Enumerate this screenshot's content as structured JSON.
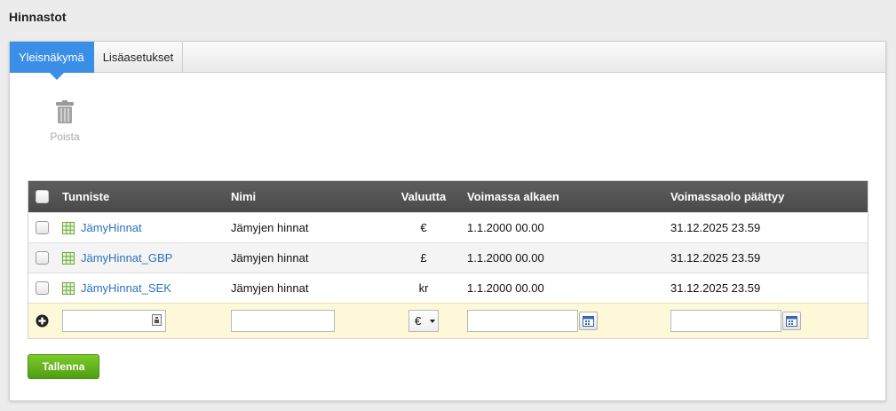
{
  "page": {
    "title": "Hinnastot"
  },
  "tabs": [
    {
      "label": "Yleisnäkymä",
      "active": true
    },
    {
      "label": "Lisäasetukset",
      "active": false
    }
  ],
  "toolbar": {
    "delete_label": "Poista",
    "delete_icon": "trash-icon"
  },
  "grid": {
    "columns": {
      "id": "Tunniste",
      "name": "Nimi",
      "currency": "Valuutta",
      "start": "Voimassa alkaen",
      "end": "Voimassaolo päättyy"
    },
    "rows": [
      {
        "id": "JämyHinnat",
        "name": "Jämyjen hinnat",
        "currency": "€",
        "start": "1.1.2000 00.00",
        "end": "31.12.2025 23.59"
      },
      {
        "id": "JämyHinnat_GBP",
        "name": "Jämyjen hinnat",
        "currency": "£",
        "start": "1.1.2000 00.00",
        "end": "31.12.2025 23.59"
      },
      {
        "id": "JämyHinnat_SEK",
        "name": "Jämyjen hinnat",
        "currency": "kr",
        "start": "1.1.2000 00.00",
        "end": "31.12.2025 23.59"
      }
    ],
    "new_row": {
      "id_value": "",
      "name_value": "",
      "currency_selected": "€",
      "start_value": "",
      "end_value": ""
    }
  },
  "actions": {
    "save_label": "Tallenna"
  },
  "colors": {
    "accent": "#3a8ee6",
    "link": "#2b72c2",
    "save": "#5fb31a",
    "header": "#555555",
    "new_row": "#fdf9d8"
  }
}
